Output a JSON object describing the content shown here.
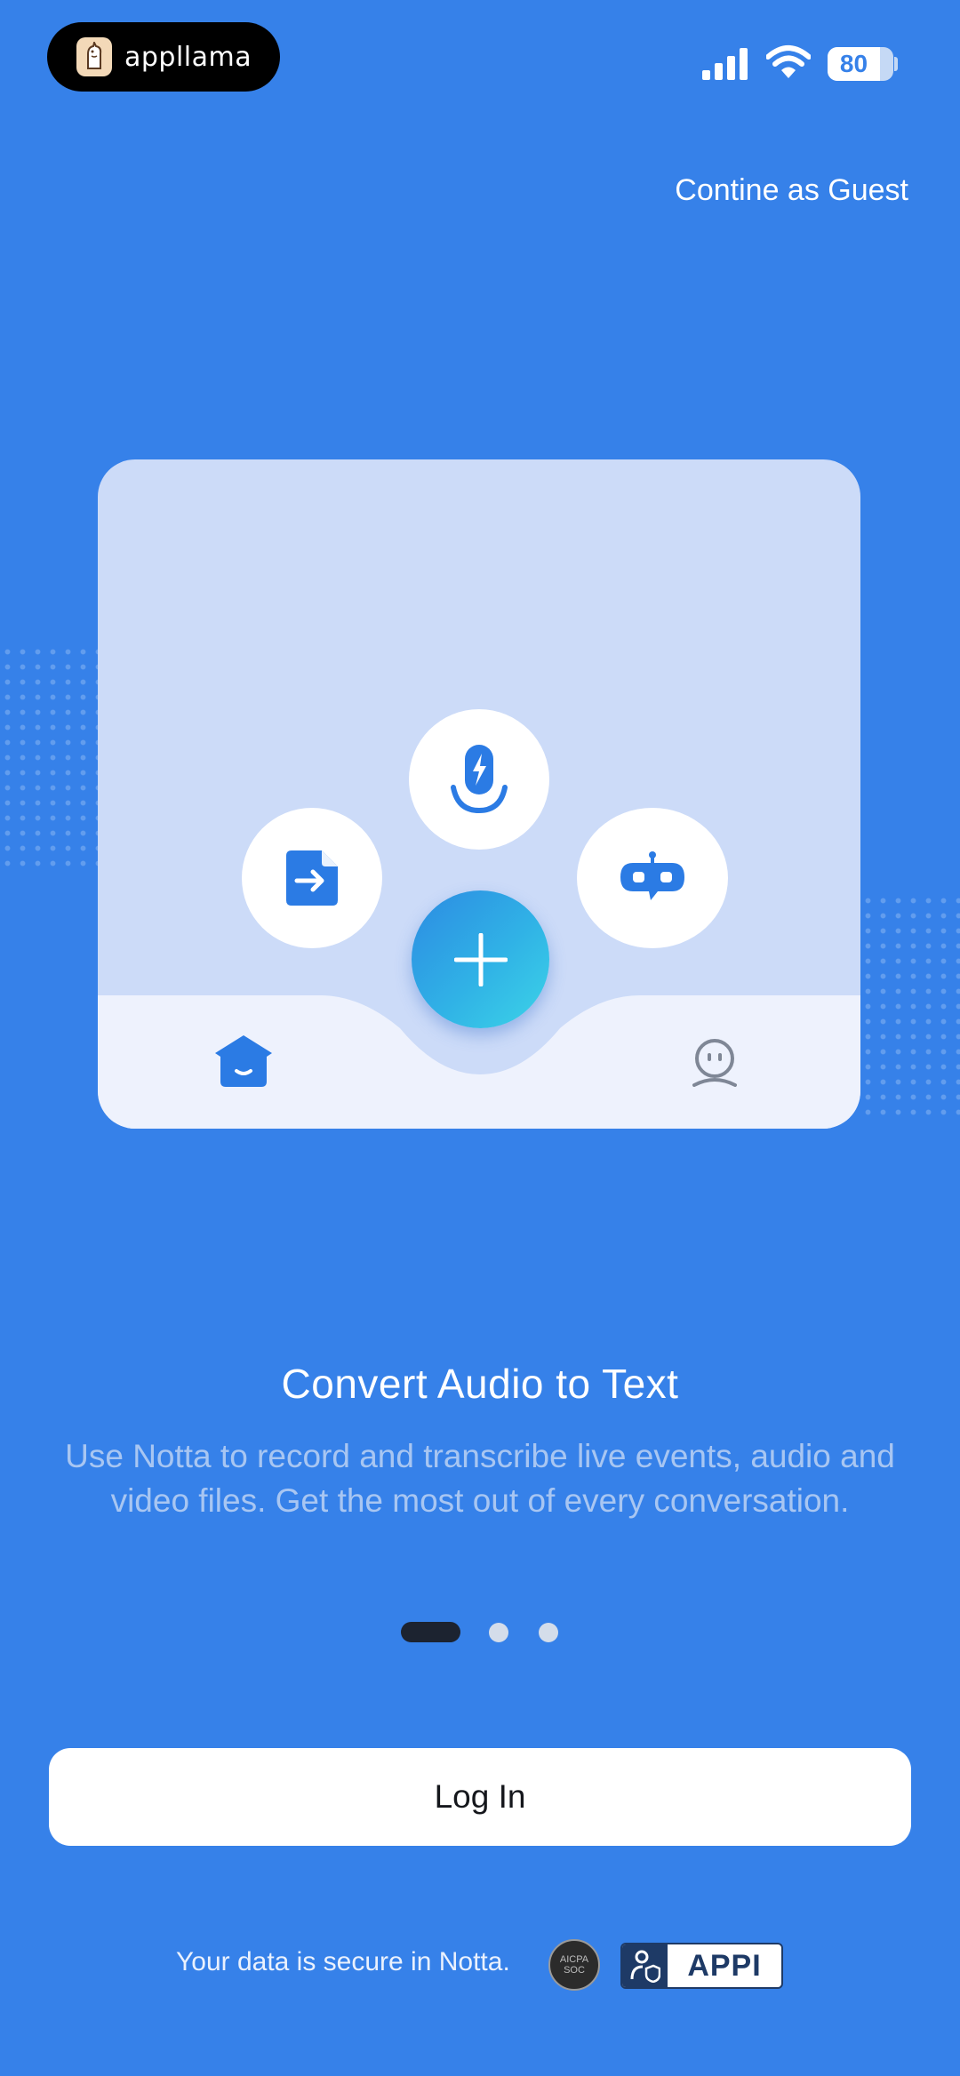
{
  "status_bar": {
    "app_badge": "appllama",
    "battery_level": "80",
    "battery_fraction": 0.8
  },
  "header": {
    "guest_link": "Contine as Guest"
  },
  "onboarding": {
    "title": "Convert Audio to Text",
    "description": "Use Notta to record and transcribe live events, audio and video files. Get the most out of every conversation.",
    "page_count": 3,
    "current_page": 1
  },
  "illustration": {
    "icons": [
      "file-import-icon",
      "microphone-bolt-icon",
      "ai-bot-icon",
      "plus-icon",
      "home-icon",
      "profile-face-icon"
    ]
  },
  "actions": {
    "login_label": "Log In"
  },
  "footer": {
    "secure_text": "Your data is secure in Notta.",
    "soc_badge_top": "AICPA",
    "soc_badge_bottom": "SOC",
    "appi_label": "APPI"
  },
  "colors": {
    "background": "#3681E9",
    "card": "#CCDBF8",
    "accent": "#2B7BE4",
    "button": "#FFFFFF"
  }
}
